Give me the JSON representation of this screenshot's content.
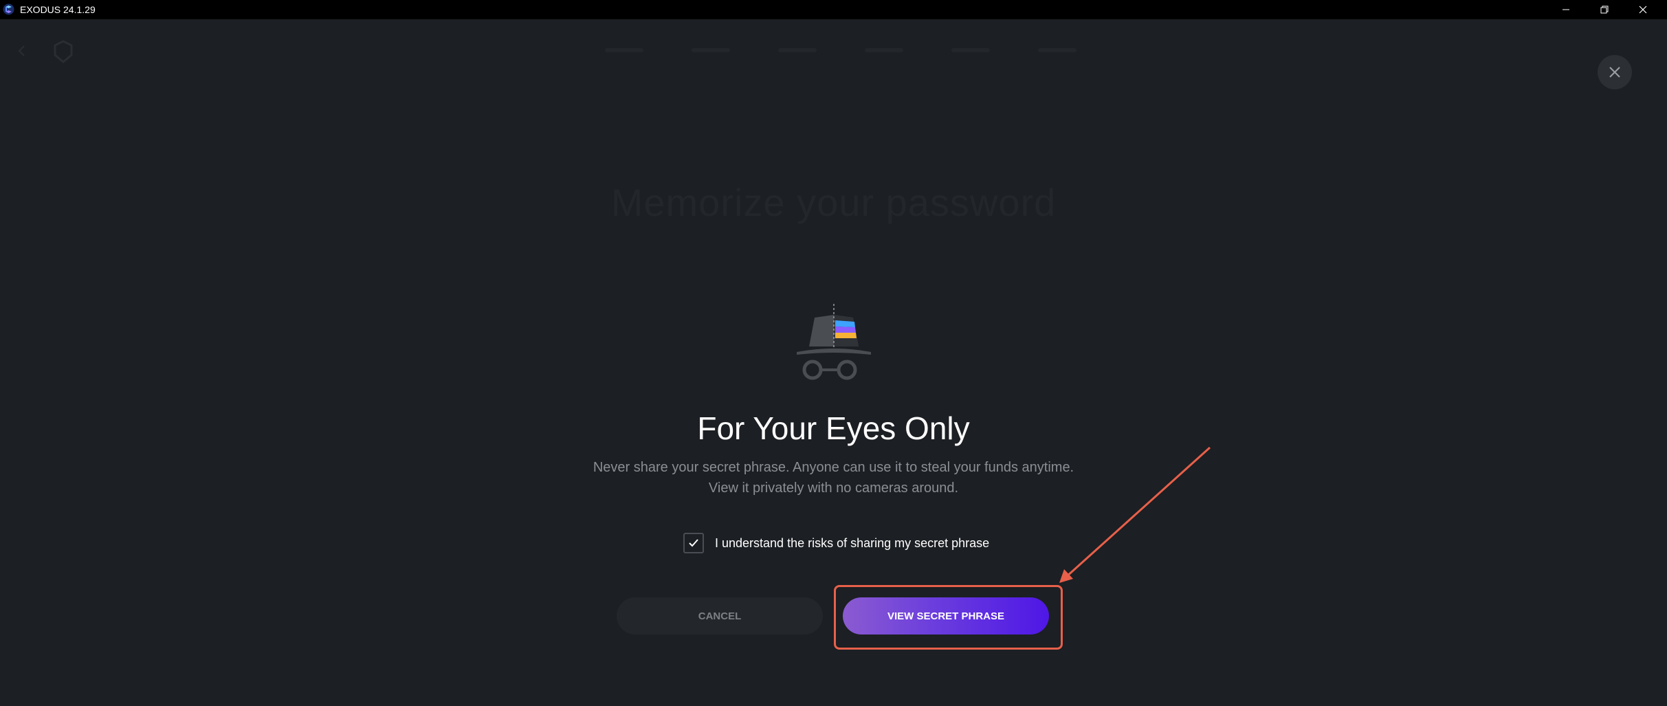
{
  "window": {
    "title": "EXODUS 24.1.29",
    "logo_icon": "exodus-logo-icon",
    "minimize_icon": "minimize-icon",
    "maximize_icon": "restore-icon",
    "close_icon": "close-icon"
  },
  "background": {
    "heading": "Memorize your password",
    "back_icon": "back-arrow-icon",
    "nav_logo_icon": "shield-logo-icon"
  },
  "dialog": {
    "icon": "incognito-spy-icon",
    "title": "For Your Eyes Only",
    "description": "Never share your secret phrase. Anyone can use it to steal your funds anytime. View it privately with no cameras around.",
    "checkbox_label": "I understand the risks of sharing my secret phrase",
    "checkbox_checked": true,
    "cancel_label": "CANCEL",
    "view_label": "VIEW SECRET PHRASE",
    "close_icon": "close-icon"
  },
  "annotation": {
    "highlight_color": "#e8604a",
    "target": "view-secret-phrase-button"
  },
  "colors": {
    "background": "#1c1f23",
    "accent_start": "#8b5bd1",
    "accent_end": "#4f17e6",
    "text_muted": "#8b8f95"
  }
}
